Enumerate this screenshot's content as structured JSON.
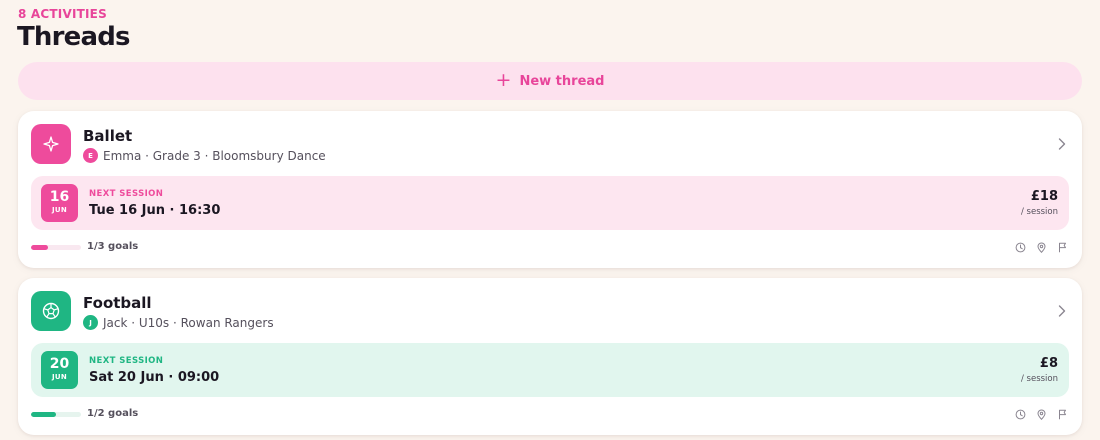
{
  "header": {
    "eyebrow": "8 ACTIVITIES",
    "title": "Threads"
  },
  "new_thread": {
    "icon": "plus-icon",
    "label": "New thread"
  },
  "threads": [
    {
      "title": "Ballet",
      "icon": "sparkle-icon",
      "accent": "#ee4b9c",
      "tint": "#fde6f0",
      "track": "#f9e8f0",
      "avatar_initial": "E",
      "subtitle": "Emma · Grade 3 · Bloomsbury Dance",
      "session_label": "NEXT SESSION",
      "day": "16",
      "month": "JUN",
      "when": "Tue 16 Jun · 16:30",
      "price": "£18",
      "per": "/ session",
      "goals_done": 1,
      "goals_total": 3,
      "goals_text": "1/3 goals"
    },
    {
      "title": "Football",
      "icon": "football-icon",
      "accent": "#1fb683",
      "tint": "#e1f6ee",
      "track": "#e6f4ee",
      "avatar_initial": "J",
      "subtitle": "Jack · U10s · Rowan Rangers",
      "session_label": "NEXT SESSION",
      "day": "20",
      "month": "JUN",
      "when": "Sat 20 Jun · 09:00",
      "price": "£8",
      "per": "/ session",
      "goals_done": 1,
      "goals_total": 2,
      "goals_text": "1/2 goals"
    }
  ],
  "colors": {
    "background": "#fbf4ee",
    "brand_pink": "#e8459a",
    "new_thread_bg": "#fde1ee"
  }
}
